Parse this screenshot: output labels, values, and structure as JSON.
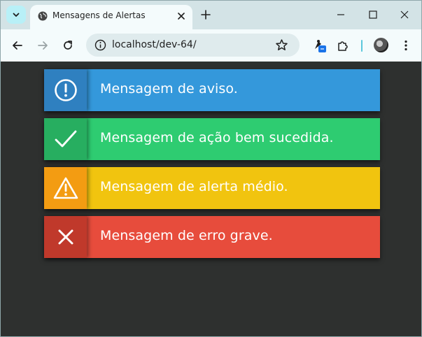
{
  "browser": {
    "tab_title": "Mensagens de Alertas",
    "url": "localhost/dev-64/"
  },
  "alerts": [
    {
      "type": "info",
      "message": "Mensagem de aviso.",
      "icon": "exclamation-circle-icon",
      "color": "#3498db",
      "icon_bg": "#2f80c0"
    },
    {
      "type": "success",
      "message": "Mensagem de ação bem sucedida.",
      "icon": "checkmark-icon",
      "color": "#2ecc71",
      "icon_bg": "#27ae60"
    },
    {
      "type": "warning",
      "message": "Mensagem de alerta médio.",
      "icon": "warning-triangle-icon",
      "color": "#f1c40f",
      "icon_bg": "#f39c12"
    },
    {
      "type": "error",
      "message": "Mensagem de erro grave.",
      "icon": "close-x-icon",
      "color": "#e74c3c",
      "icon_bg": "#c0392b"
    }
  ]
}
